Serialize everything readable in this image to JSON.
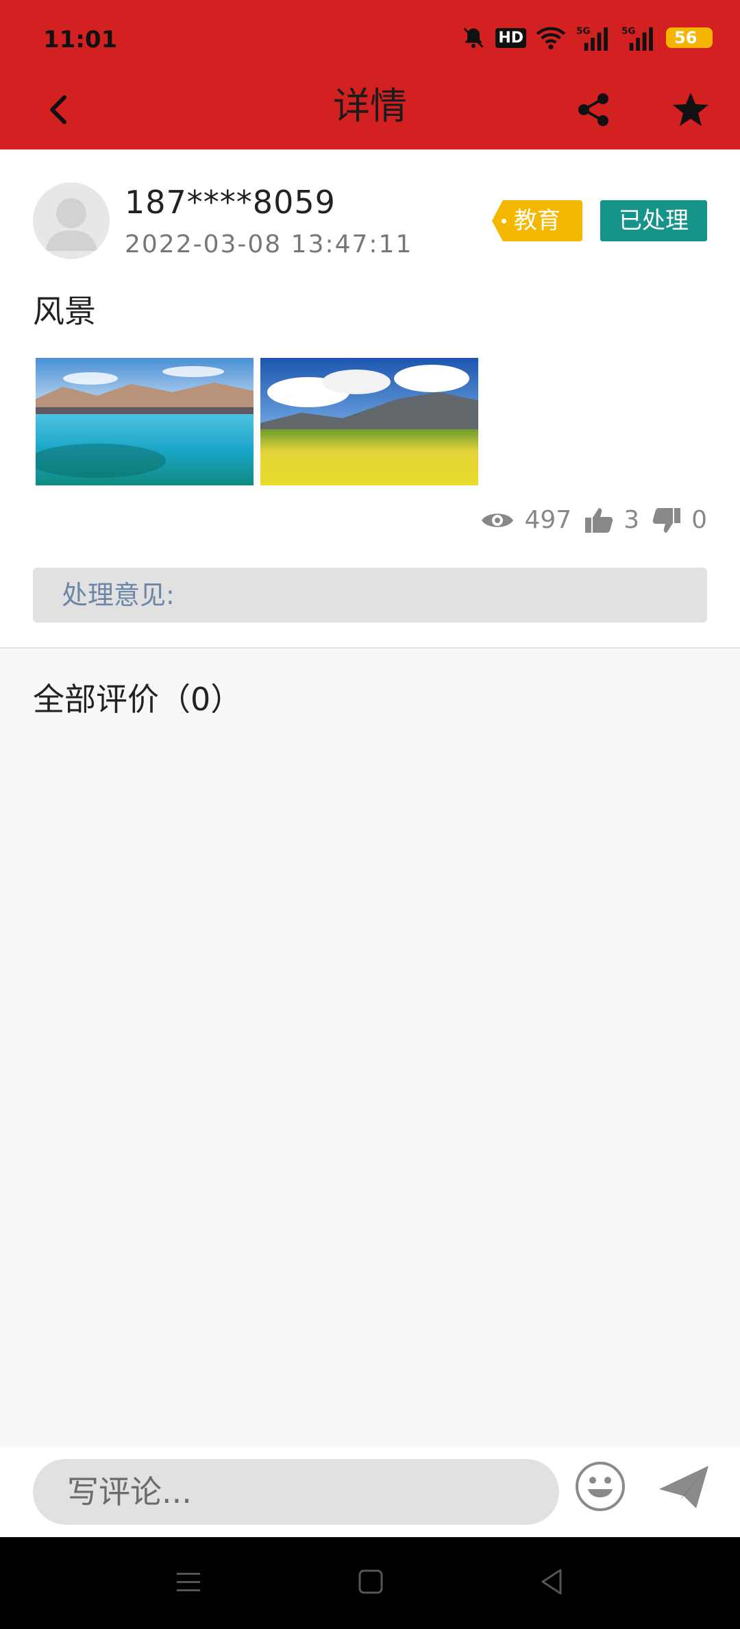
{
  "status_bar": {
    "time": "11:01",
    "hd_label": "HD",
    "battery": "56"
  },
  "nav": {
    "title": "详情"
  },
  "post": {
    "username": "187****8059",
    "datetime": "2022-03-08  13:47:11",
    "category_tag": "教育",
    "status_badge": "已处理",
    "text": "风景",
    "images": [
      "lake-landscape",
      "rapeseed-field-landscape"
    ],
    "stats": {
      "views": "497",
      "likes": "3",
      "dislikes": "0"
    },
    "opinion_label": "处理意见:"
  },
  "comments": {
    "title": "全部评价（0）"
  },
  "input": {
    "placeholder": "写评论..."
  },
  "colors": {
    "header": "#d32121",
    "tag": "#f5b800",
    "badge": "#17948a"
  },
  "icons": [
    "back-icon",
    "share-icon",
    "star-icon",
    "eye-icon",
    "thumbs-up-icon",
    "thumbs-down-icon",
    "emoji-icon",
    "send-icon"
  ]
}
